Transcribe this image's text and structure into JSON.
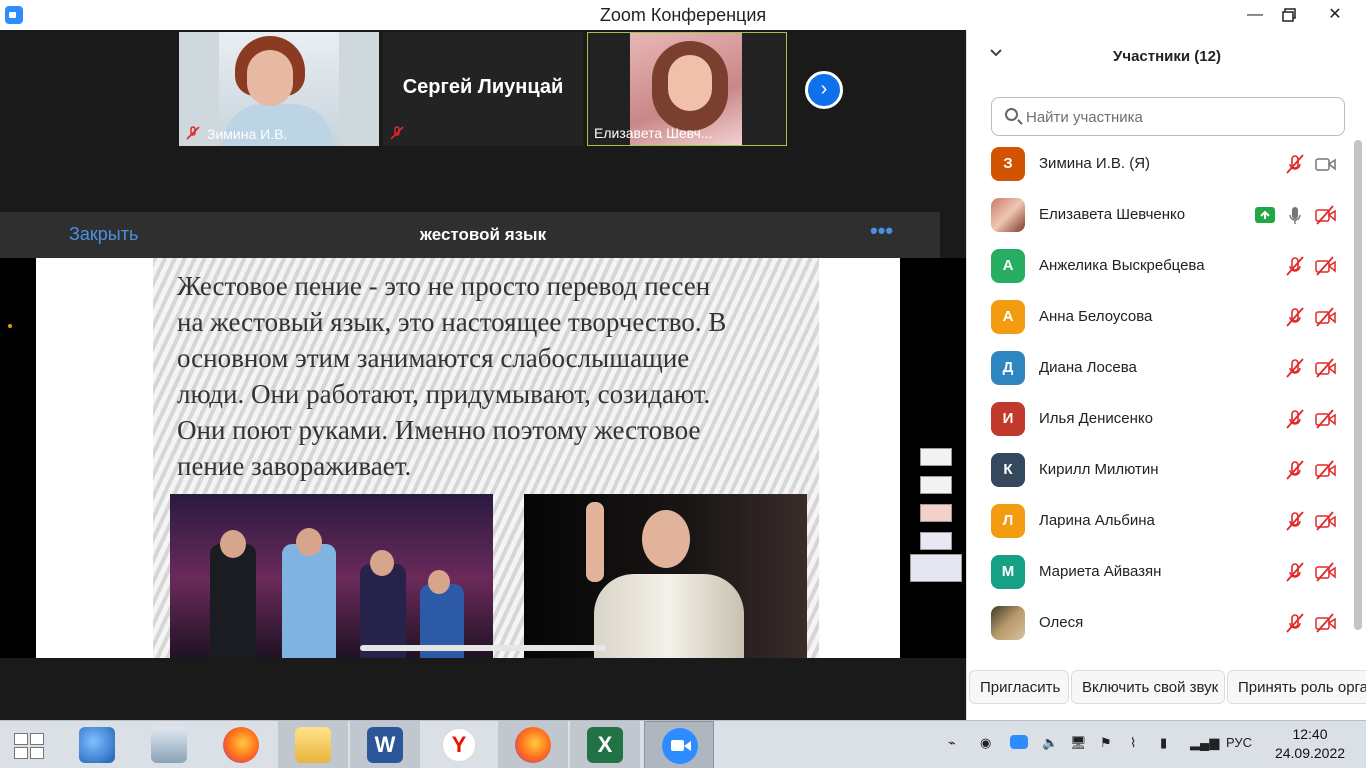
{
  "window": {
    "title": "Zoom Конференция"
  },
  "videos": [
    {
      "name": "Зимина И.В.",
      "muted": true
    },
    {
      "name": "Сергей Лиунцай",
      "muted": true
    },
    {
      "name": "Елизавета Шевч..."
    }
  ],
  "share": {
    "close_label": "Закрыть",
    "title": "жестовой язык",
    "more_icon": "more-dots-icon",
    "slide_text_lines": [
      "Жестовое пение - это не просто перевод песен",
      "на жестовый язык, это настоящее творчество. В",
      "основном этим занимаются слабослышащие",
      "люди. Они работают, придумывают, созидают.",
      "Они поют руками. Именно поэтому жестовое",
      "пение завораживает."
    ]
  },
  "participants_panel": {
    "header": "Участники (12)",
    "search_placeholder": "Найти участника",
    "participants": [
      {
        "name": "Зимина И.В. (Я)",
        "initial": "З",
        "color": "#d35400",
        "mic": "muted",
        "cam": "on"
      },
      {
        "name": "Елизавета Шевченко",
        "initial": "",
        "color": "",
        "mic": "on",
        "cam": "off",
        "sharing": true
      },
      {
        "name": "Анжелика Выскребцева",
        "initial": "А",
        "color": "#27ae60",
        "mic": "muted",
        "cam": "off"
      },
      {
        "name": "Анна Белоусова",
        "initial": "А",
        "color": "#f39c12",
        "mic": "muted",
        "cam": "off"
      },
      {
        "name": "Диана Лосева",
        "initial": "Д",
        "color": "#2e86c1",
        "mic": "muted",
        "cam": "off"
      },
      {
        "name": "Илья Денисенко",
        "initial": "И",
        "color": "#c0392b",
        "mic": "muted",
        "cam": "off"
      },
      {
        "name": "Кирилл Милютин",
        "initial": "К",
        "color": "#34495e",
        "mic": "muted",
        "cam": "off"
      },
      {
        "name": "Ларина Альбина",
        "initial": "Л",
        "color": "#f39c12",
        "mic": "muted",
        "cam": "off"
      },
      {
        "name": "Мариета Айвазян",
        "initial": "М",
        "color": "#16a085",
        "mic": "muted",
        "cam": "off"
      },
      {
        "name": "Олеся",
        "initial": "",
        "color": "",
        "mic": "muted",
        "cam": "off"
      }
    ],
    "buttons": [
      "Пригласить",
      "Включить свой звук",
      "Принять роль орга"
    ]
  },
  "taskbar": {
    "language": "РУС",
    "time": "12:40",
    "date": "24.09.2022",
    "apps": [
      "start-icon",
      "thunderbird-icon",
      "control-panel-icon",
      "firefox-icon",
      "file-explorer-icon",
      "word-icon",
      "yandex-browser-icon",
      "firefox-icon",
      "excel-icon",
      "zoom-icon"
    ]
  },
  "colors": {
    "zoom_blue": "#2D8CFF",
    "mute_red": "#e02828",
    "share_green": "#23a745"
  }
}
